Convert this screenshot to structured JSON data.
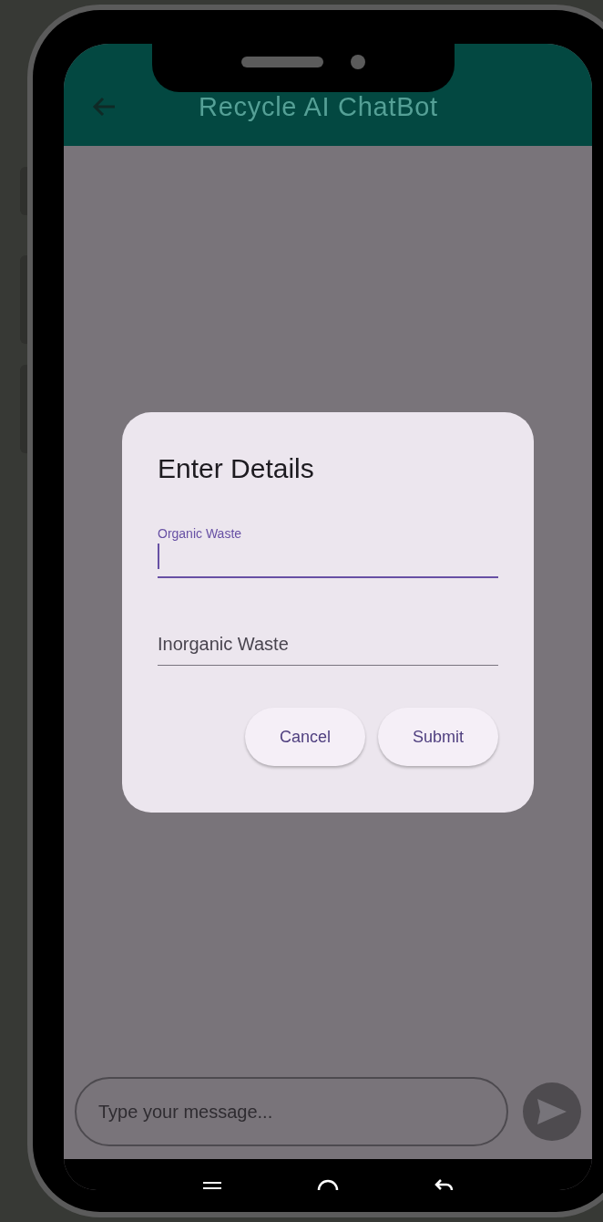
{
  "app_bar": {
    "title": "Recycle AI ChatBot"
  },
  "dialog": {
    "title": "Enter Details",
    "fields": [
      {
        "label": "Organic Waste",
        "focused": true
      },
      {
        "placeholder": "Inorganic Waste",
        "focused": false
      }
    ],
    "buttons": [
      "Cancel",
      "Submit"
    ]
  },
  "message_input": {
    "placeholder": "Type your message..."
  }
}
